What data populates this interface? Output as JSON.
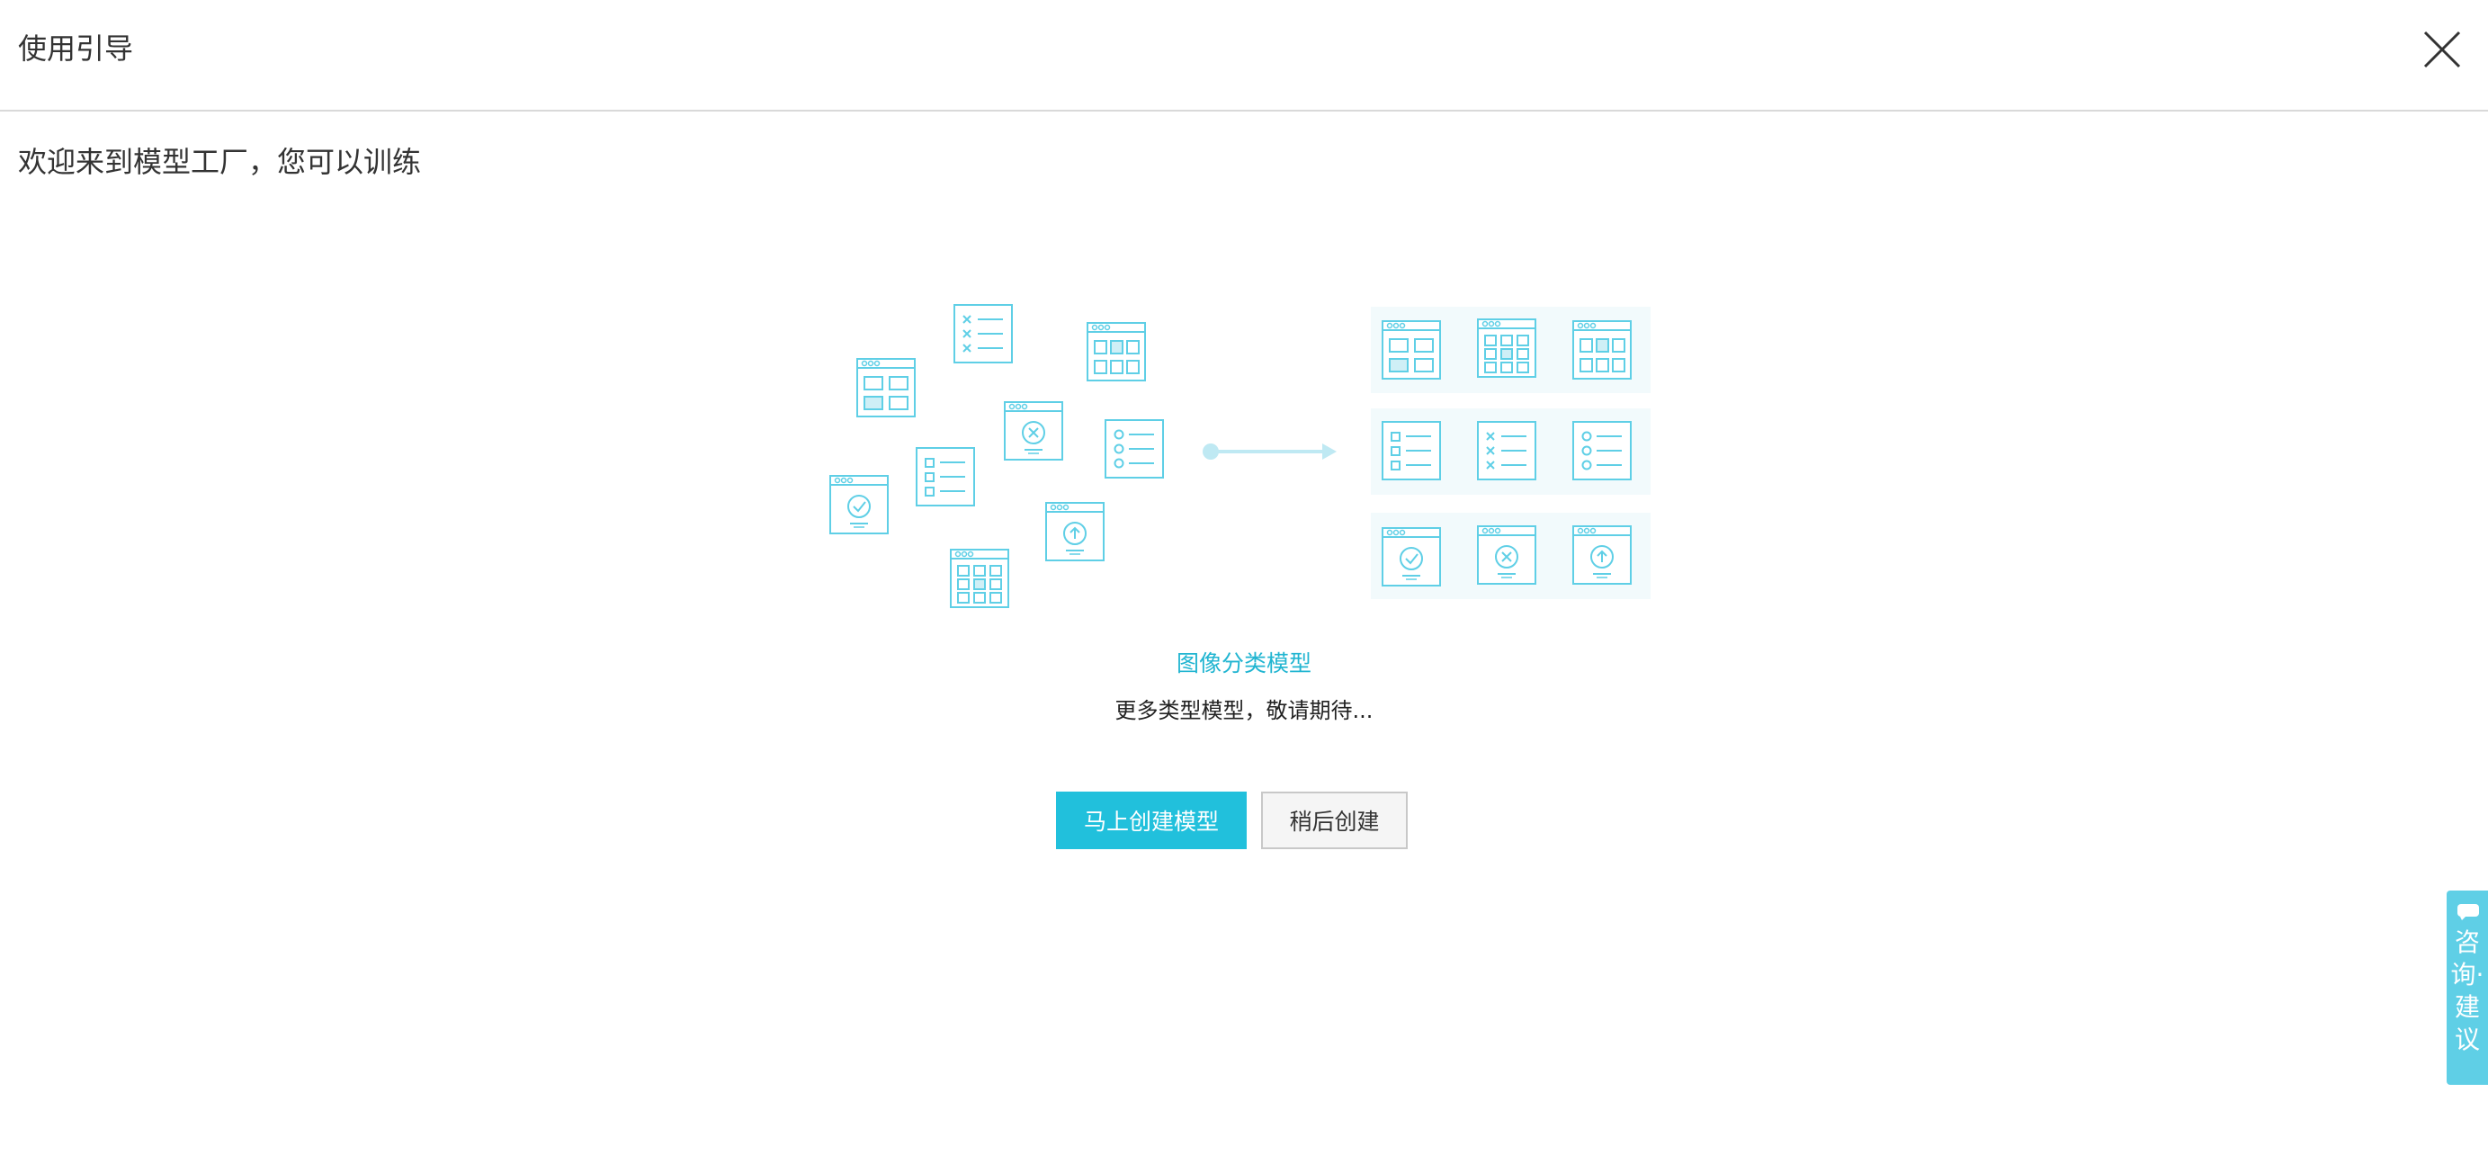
{
  "dialog": {
    "title": "使用引导",
    "welcome_text": "欢迎来到模型工厂，您可以训练"
  },
  "model": {
    "name": "图像分类模型",
    "more_text": "更多类型模型，敬请期待..."
  },
  "actions": {
    "create_now": "马上创建模型",
    "create_later": "稍后创建"
  },
  "feedback": {
    "label": "咨询·建议"
  },
  "colors": {
    "accent": "#21c0dc",
    "illustration": "#5fcfe6",
    "panel_bg": "#f2fafc"
  }
}
